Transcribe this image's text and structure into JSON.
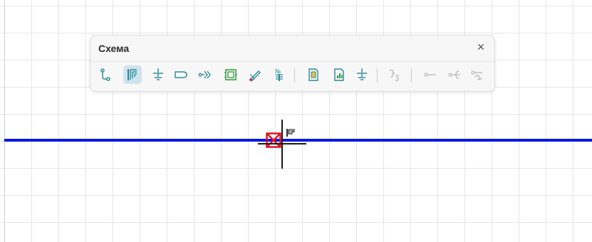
{
  "panel": {
    "title": "Схема",
    "close_glyph": "×",
    "tools": [
      {
        "name": "connector-icon",
        "active": false,
        "enabled": true
      },
      {
        "name": "bus-icon",
        "active": true,
        "enabled": true
      },
      {
        "name": "ground-icon",
        "active": false,
        "enabled": true
      },
      {
        "name": "terminal-icon",
        "active": false,
        "enabled": true
      },
      {
        "name": "arrow-signal-icon",
        "active": false,
        "enabled": true
      },
      {
        "name": "module-icon",
        "active": false,
        "enabled": true
      },
      {
        "name": "pencil-wire-icon",
        "active": false,
        "enabled": true
      },
      {
        "name": "numbered-bus-icon",
        "active": false,
        "enabled": true
      },
      {
        "name": "document-icon",
        "active": false,
        "enabled": true
      },
      {
        "name": "report-icon",
        "active": false,
        "enabled": true
      },
      {
        "name": "ground-alt-icon",
        "active": false,
        "enabled": true
      },
      {
        "name": "signature-icon",
        "active": false,
        "enabled": false
      },
      {
        "name": "contact-open-icon",
        "active": false,
        "enabled": false
      },
      {
        "name": "contact-branch-icon",
        "active": false,
        "enabled": false
      },
      {
        "name": "contact-loop-icon",
        "active": false,
        "enabled": false
      }
    ],
    "tool_labels": {
      "numbered": "№"
    }
  },
  "colors": {
    "wire": "#0a18e6",
    "marker": "#e0141e",
    "active_tool_bg": "#cfe3ef",
    "icon_teal": "#2a8a9a",
    "icon_green": "#2a9a3a",
    "icon_blue": "#4a6ad0",
    "icon_disabled": "#b8b8b8"
  }
}
